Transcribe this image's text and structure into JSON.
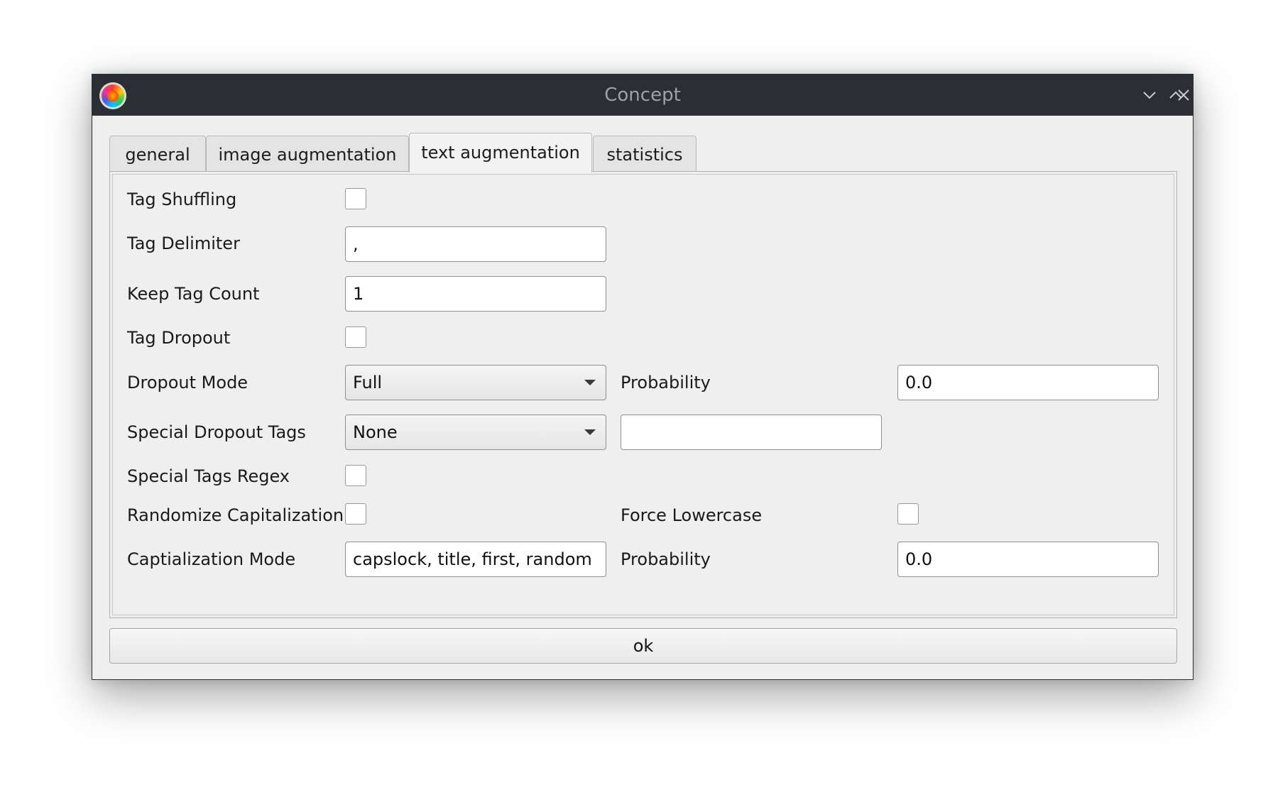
{
  "window": {
    "title": "Concept",
    "buttons": [
      "minimize",
      "maximize",
      "close"
    ]
  },
  "tabs": [
    {
      "label": "general",
      "active": false
    },
    {
      "label": "image augmentation",
      "active": false
    },
    {
      "label": "text augmentation",
      "active": true
    },
    {
      "label": "statistics",
      "active": false
    }
  ],
  "form": {
    "tag_shuffling": {
      "label": "Tag Shuffling",
      "checked": false
    },
    "tag_delimiter": {
      "label": "Tag Delimiter",
      "value": ","
    },
    "keep_tag_count": {
      "label": "Keep Tag Count",
      "value": "1"
    },
    "tag_dropout": {
      "label": "Tag Dropout",
      "checked": false
    },
    "dropout_mode": {
      "label": "Dropout Mode",
      "value": "Full"
    },
    "dropout_probability": {
      "label": "Probability",
      "value": "0.0"
    },
    "special_dropout_tags": {
      "label": "Special Dropout Tags",
      "value": "None",
      "text_value": ""
    },
    "special_tags_regex": {
      "label": "Special Tags Regex",
      "checked": false
    },
    "randomize_capitalization": {
      "label": "Randomize Capitalization",
      "checked": false
    },
    "force_lowercase": {
      "label": "Force Lowercase",
      "checked": false
    },
    "capitalization_mode": {
      "label": "Captialization Mode",
      "value": "capslock, title, first, random"
    },
    "capitalization_probability": {
      "label": "Probability",
      "value": "0.0"
    }
  },
  "footer": {
    "ok_label": "ok"
  }
}
